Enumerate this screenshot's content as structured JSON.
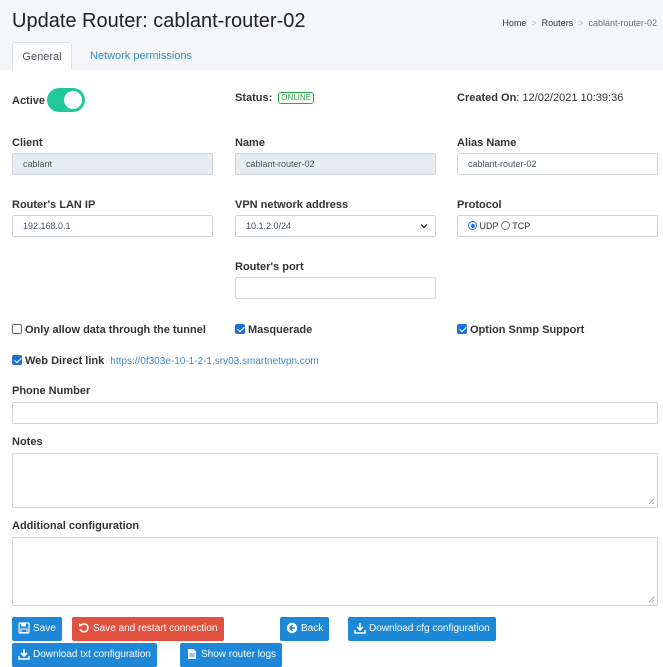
{
  "page": {
    "title": "Update Router: cablant-router-02"
  },
  "breadcrumb": {
    "home": "Home",
    "routers": "Routers",
    "current": "cablant-router-02"
  },
  "tabs": {
    "general": "General",
    "network_permissions": "Network permissions"
  },
  "status_row": {
    "active_label": "Active",
    "active_on": true,
    "status_label": "Status:",
    "status_badge": "ONLINE",
    "created_label": "Created On",
    "created_value": ": 12/02/2021 10:39:36"
  },
  "client": {
    "label": "Client",
    "value": "cablant"
  },
  "name": {
    "label": "Name",
    "value": "cablant-router-02"
  },
  "alias": {
    "label": "Alias Name",
    "value": "cablant-router-02"
  },
  "lan_ip": {
    "label": "Router's LAN IP",
    "value": "192.168.0.1"
  },
  "vpn": {
    "label": "VPN network address",
    "value": "10.1.2.0/24"
  },
  "protocol": {
    "label": "Protocol",
    "udp": "UDP",
    "tcp": "TCP",
    "selected": "UDP"
  },
  "port": {
    "label": "Router's port",
    "value": ""
  },
  "checkboxes": {
    "tunnel_only": {
      "label": "Only allow data through the tunnel",
      "checked": false
    },
    "masquerade": {
      "label": "Masquerade",
      "checked": true
    },
    "snmp": {
      "label": "Option Snmp Support",
      "checked": true
    },
    "web_direct": {
      "label": "Web Direct link",
      "checked": true,
      "url": "https://0f303e-10-1-2-1.srv03.smartnetvpn.com"
    }
  },
  "phone": {
    "label": "Phone Number",
    "value": ""
  },
  "notes": {
    "label": "Notes",
    "value": ""
  },
  "additional": {
    "label": "Additional configuration",
    "value": ""
  },
  "buttons": {
    "save": "Save",
    "save_restart": "Save and restart connection",
    "back": "Back",
    "download_cfg": "Download cfg configuration",
    "download_txt": "Download txt configuration",
    "show_logs": "Show router logs"
  },
  "colors": {
    "accent": "#1e88d8",
    "danger": "#e15140",
    "toggle": "#20c997",
    "online": "#28a745",
    "link": "#3c8dbc"
  }
}
